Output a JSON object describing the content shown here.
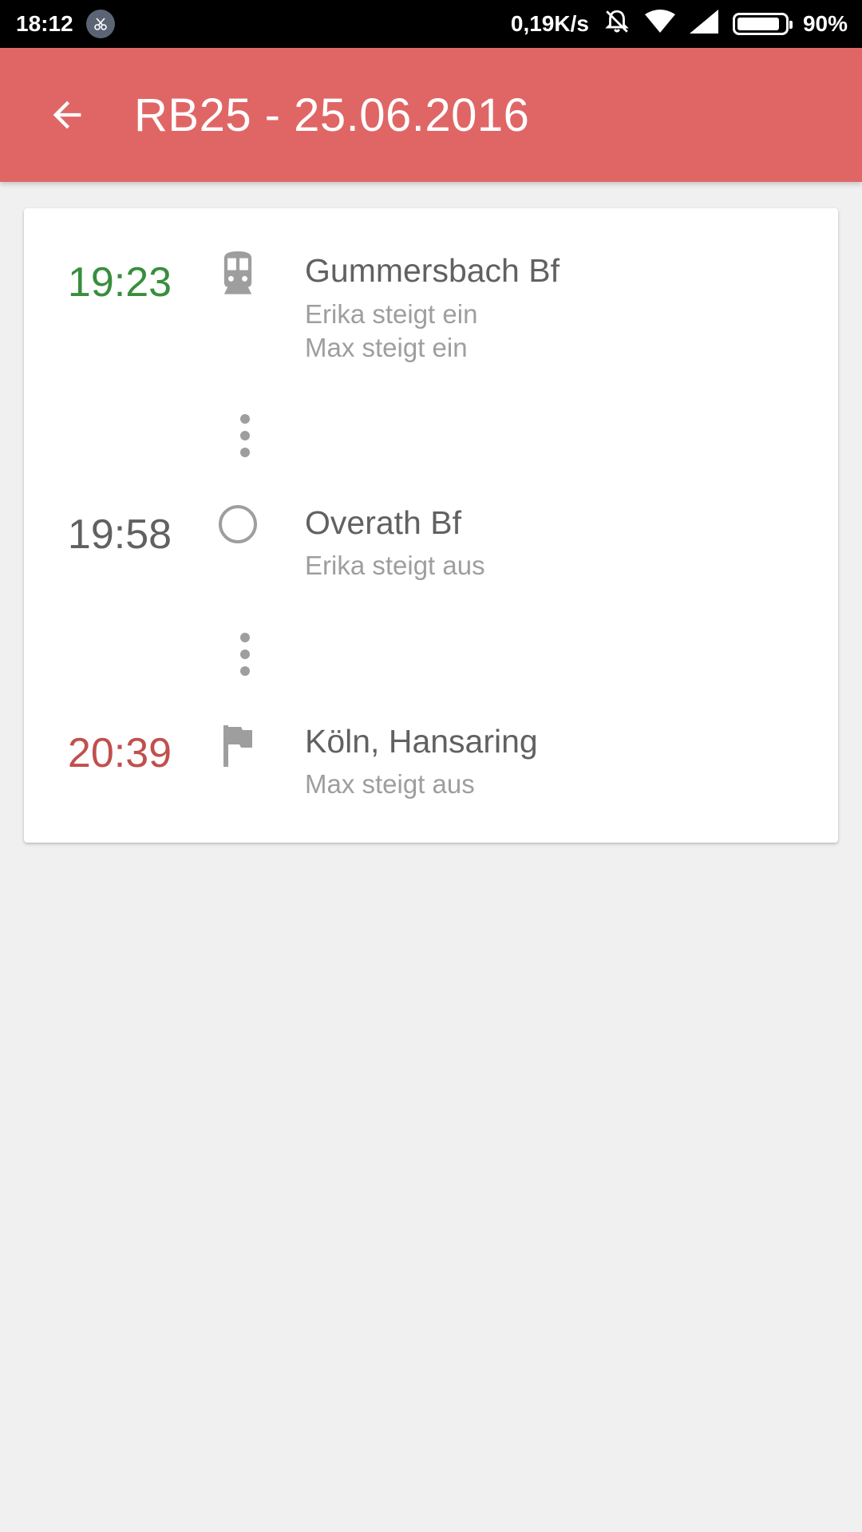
{
  "status_bar": {
    "time": "18:12",
    "speed": "0,19K/s",
    "battery": "90%",
    "battery_level": 0.9
  },
  "app_bar": {
    "title": "RB25 - 25.06.2016"
  },
  "stops": [
    {
      "time": "19:23",
      "time_color": "#388e3c",
      "icon": "train-icon",
      "name": "Gummersbach Bf",
      "events": [
        "Erika steigt ein",
        "Max steigt ein"
      ]
    },
    {
      "time": "19:58",
      "time_color": "#616161",
      "icon": "circle-icon",
      "name": "Overath Bf",
      "events": [
        "Erika steigt aus"
      ]
    },
    {
      "time": "20:39",
      "time_color": "#c0504d",
      "icon": "flag-icon",
      "name": "Köln, Hansaring",
      "events": [
        "Max steigt aus"
      ]
    }
  ],
  "colors": {
    "app_bar": "#e06666",
    "background": "#f0f0f0"
  }
}
